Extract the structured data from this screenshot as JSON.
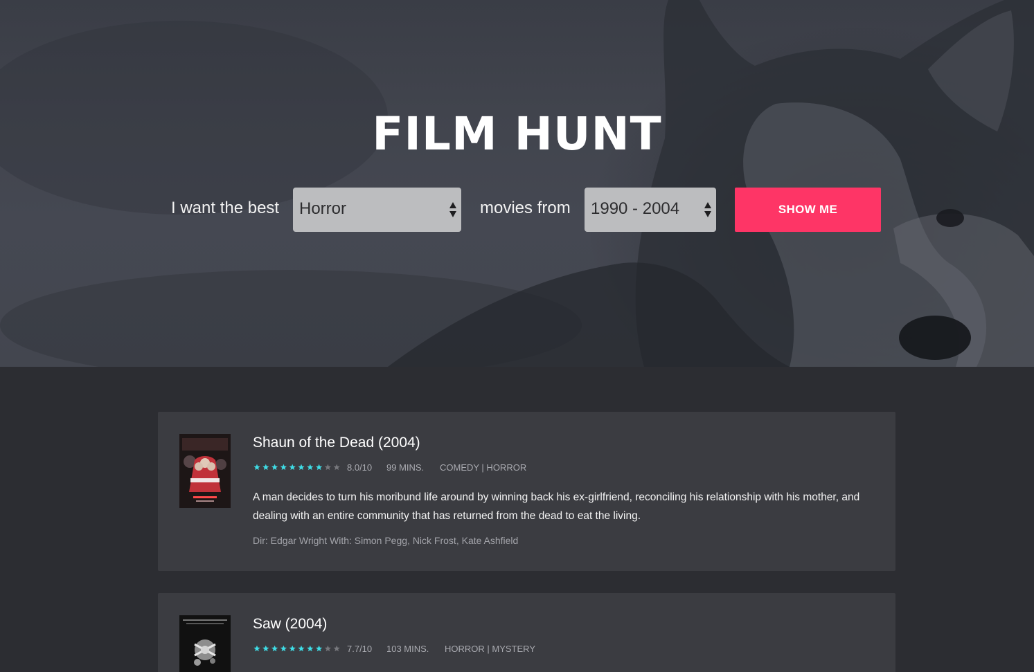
{
  "app": {
    "logo": "FILM HUNT"
  },
  "search": {
    "prefix": "I want the best",
    "genre_value": "Horror",
    "middle": "movies from",
    "years_value": "1990 - 2004",
    "button_label": "SHOW ME"
  },
  "colors": {
    "accent": "#fe3566",
    "star_on": "#3fdde6",
    "star_off": "#77787d",
    "card_bg": "#3b3c41"
  },
  "results": [
    {
      "title": "Shaun of the Dead (2004)",
      "rating_value": 8.0,
      "rating": "8.0/10",
      "runtime": "99 MINS.",
      "genres": "COMEDY | HORROR",
      "plot": "A man decides to turn his moribund life around by winning back his ex-girlfriend, reconciling his relationship with his mother, and dealing with an entire community that has returned from the dead to eat the living.",
      "credits": "Dir: Edgar Wright With: Simon Pegg, Nick Frost, Kate Ashfield"
    },
    {
      "title": "Saw (2004)",
      "rating_value": 7.7,
      "rating": "7.7/10",
      "runtime": "103 MINS.",
      "genres": "HORROR | MYSTERY"
    }
  ]
}
